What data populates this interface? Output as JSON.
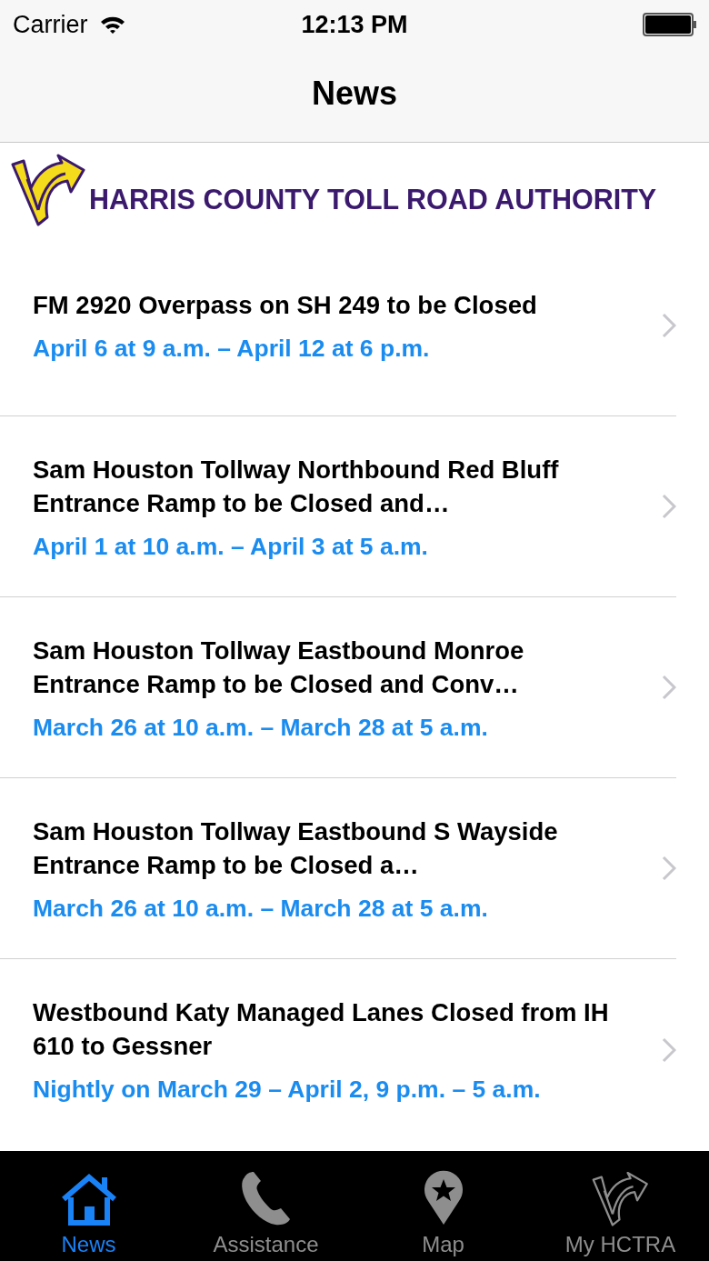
{
  "status_bar": {
    "carrier": "Carrier",
    "time": "12:13 PM"
  },
  "nav_bar": {
    "title": "News"
  },
  "banner": {
    "title": "HARRIS COUNTY TOLL ROAD AUTHORITY"
  },
  "news": [
    {
      "title": "FM 2920 Overpass on SH 249 to be Closed",
      "dates": "April 6 at 9 a.m. – April 12 at 6 p.m."
    },
    {
      "title": "Sam Houston Tollway Northbound Red Bluff Entrance Ramp to be Closed and…",
      "dates": "April 1 at 10 a.m. – April 3 at 5 a.m."
    },
    {
      "title": "Sam Houston Tollway Eastbound Monroe Entrance Ramp to be Closed and Conv…",
      "dates": "March 26 at 10 a.m. – March 28 at 5 a.m."
    },
    {
      "title": "Sam Houston Tollway Eastbound S Wayside Entrance Ramp to be Closed a…",
      "dates": "March 26 at 10 a.m. – March 28 at 5 a.m."
    },
    {
      "title": "Westbound Katy Managed Lanes Closed from IH 610 to Gessner",
      "dates": "Nightly on March 29 – April 2, 9 p.m. – 5 a.m."
    }
  ],
  "tab_bar": [
    {
      "label": "News",
      "selected": true
    },
    {
      "label": "Assistance",
      "selected": false
    },
    {
      "label": "Map",
      "selected": false
    },
    {
      "label": "My HCTRA",
      "selected": false
    }
  ]
}
